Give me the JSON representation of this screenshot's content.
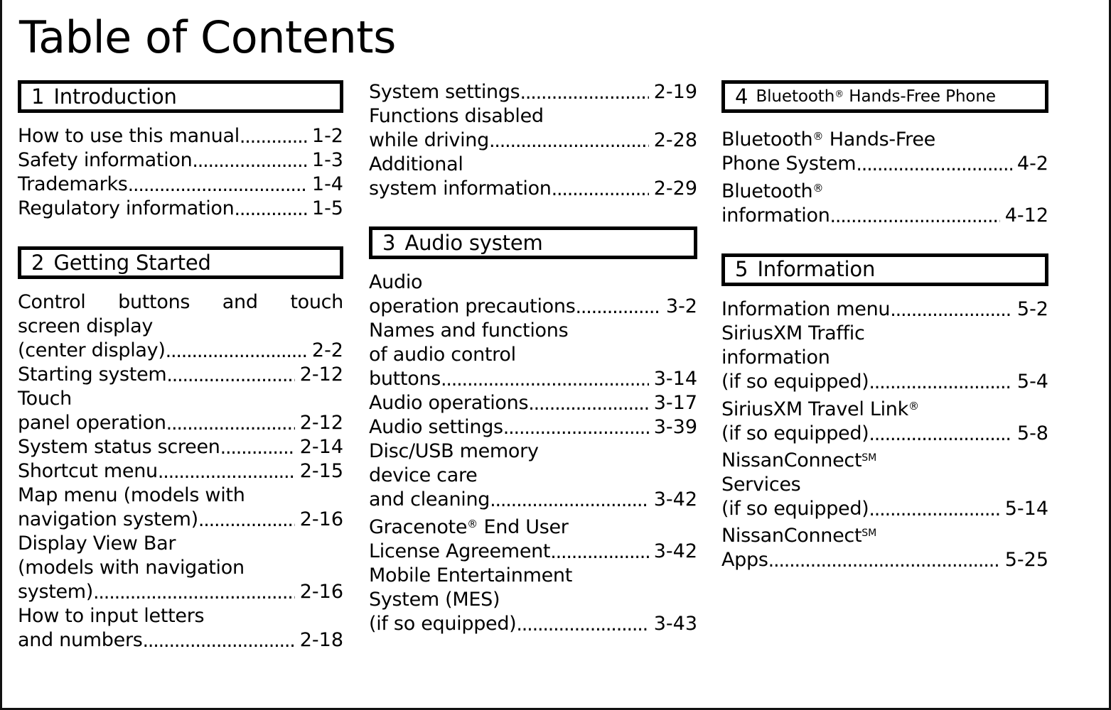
{
  "page": {
    "title": "Table of Contents"
  },
  "columns": [
    {
      "id": "column-1",
      "sections": [
        {
          "id": "section-1",
          "number": "1",
          "name": "Introduction",
          "entries": [
            {
              "lines": [
                "How to use this manual"
              ],
              "page": "1-2"
            },
            {
              "lines": [
                "Safety information"
              ],
              "page": "1-3"
            },
            {
              "lines": [
                "Trademarks"
              ],
              "page": "1-4"
            },
            {
              "lines": [
                "Regulatory information"
              ],
              "page": "1-5"
            }
          ]
        },
        {
          "id": "section-2",
          "number": "2",
          "name": "Getting Started",
          "entries": [
            {
              "lines": [
                "Control buttons and touch",
                "screen display",
                "(center display)"
              ],
              "page": "2-2",
              "justify_first": true
            },
            {
              "lines": [
                "Starting system"
              ],
              "page": "2-12"
            },
            {
              "lines": [
                "Touch",
                "panel operation"
              ],
              "page": "2-12"
            },
            {
              "lines": [
                "System status screen"
              ],
              "page": "2-14"
            },
            {
              "lines": [
                "Shortcut menu"
              ],
              "page": "2-15"
            },
            {
              "lines": [
                "Map menu (models with",
                "navigation system)"
              ],
              "page": "2-16"
            },
            {
              "lines": [
                "Display View Bar",
                "(models with navigation",
                "system)"
              ],
              "page": "2-16"
            },
            {
              "lines": [
                "How to input letters",
                "and numbers"
              ],
              "page": "2-18"
            }
          ]
        }
      ]
    },
    {
      "id": "column-2",
      "sections": [
        {
          "id": "section-2-cont",
          "number": "",
          "name": "",
          "no_box": true,
          "entries": [
            {
              "lines": [
                "System settings"
              ],
              "page": "2-19"
            },
            {
              "lines": [
                "Functions disabled",
                "while driving"
              ],
              "page": "2-28"
            },
            {
              "lines": [
                "Additional",
                "system information"
              ],
              "page": "2-29"
            }
          ]
        },
        {
          "id": "section-3",
          "number": "3",
          "name": "Audio system",
          "entries": [
            {
              "lines": [
                "Audio",
                "operation precautions"
              ],
              "page": "3-2"
            },
            {
              "lines": [
                "Names and functions",
                "of audio control",
                "buttons"
              ],
              "page": "3-14"
            },
            {
              "lines": [
                "Audio operations"
              ],
              "page": "3-17"
            },
            {
              "lines": [
                "Audio settings"
              ],
              "page": "3-39"
            },
            {
              "lines": [
                "Disc/USB memory",
                "device care",
                "and cleaning"
              ],
              "page": "3-42"
            },
            {
              "lines": [
                "Gracenote® End User",
                "License Agreement"
              ],
              "page": "3-42",
              "sup_first": "®"
            },
            {
              "lines": [
                "Mobile Entertainment",
                "System (MES)",
                "(if so equipped)"
              ],
              "page": "3-43"
            }
          ]
        }
      ]
    },
    {
      "id": "column-3",
      "sections": [
        {
          "id": "section-4",
          "number": "4",
          "name": "Bluetooth® Hands-Free Phone",
          "small_title": true,
          "entries": [
            {
              "lines": [
                "Bluetooth® Hands-Free",
                "Phone System"
              ],
              "page": "4-2"
            },
            {
              "lines": [
                "Bluetooth®",
                "information"
              ],
              "page": "4-12"
            }
          ]
        },
        {
          "id": "section-5",
          "number": "5",
          "name": "Information",
          "entries": [
            {
              "lines": [
                "Information menu"
              ],
              "page": "5-2"
            },
            {
              "lines": [
                "SiriusXM Traffic",
                "information",
                "(if so equipped)"
              ],
              "page": "5-4"
            },
            {
              "lines": [
                "SiriusXM Travel Link®",
                "(if so equipped)"
              ],
              "page": "5-8"
            },
            {
              "lines": [
                "NissanConnectᴸᴹ",
                "Services",
                "(if so equipped)"
              ],
              "page": "5-14"
            },
            {
              "lines": [
                "NissanConnectᴸᴹ",
                "Apps"
              ],
              "page": "5-25"
            }
          ]
        }
      ]
    }
  ],
  "leader": {
    "dot_char": "."
  }
}
